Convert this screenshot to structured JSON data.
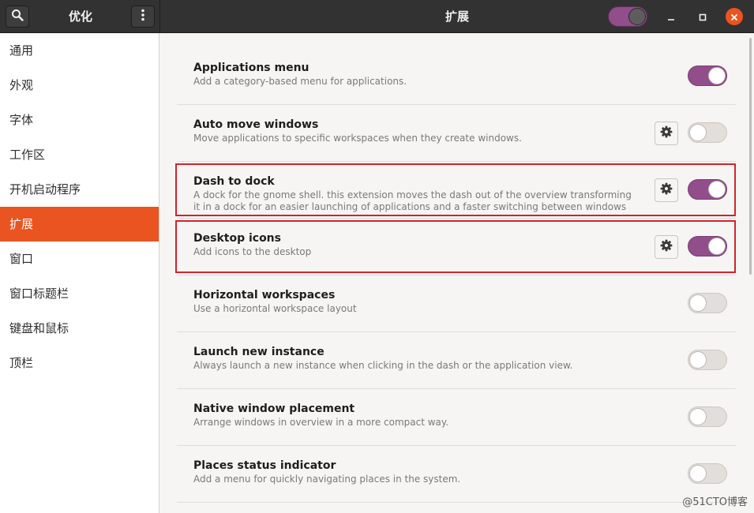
{
  "header": {
    "sidebar_title": "优化",
    "main_title": "扩展",
    "global_switch_on": true,
    "accent_color": "#924d8b",
    "close_color": "#e9541f",
    "search_icon": "search-icon",
    "menu_icon": "vertical-dots-icon"
  },
  "sidebar": {
    "active_color": "#e95420",
    "items": [
      {
        "label": "通用"
      },
      {
        "label": "外观"
      },
      {
        "label": "字体"
      },
      {
        "label": "工作区"
      },
      {
        "label": "开机启动程序"
      },
      {
        "label": "扩展",
        "active": true
      },
      {
        "label": "窗口"
      },
      {
        "label": "窗口标题栏"
      },
      {
        "label": "键盘和鼠标"
      },
      {
        "label": "顶栏"
      }
    ]
  },
  "extensions": [
    {
      "title": "Applications menu",
      "description": "Add a category-based menu for applications.",
      "enabled": true,
      "has_settings": false
    },
    {
      "title": "Auto move windows",
      "description": "Move applications to specific workspaces when they create windows.",
      "enabled": false,
      "has_settings": true
    },
    {
      "title": "Dash to dock",
      "description": "A dock for the gnome shell. this extension moves the dash out of the overview transforming it in a dock for an easier launching of applications and a faster switching between windows and desktops. s…",
      "enabled": true,
      "has_settings": true,
      "highlighted": true
    },
    {
      "title": "Desktop icons",
      "description": "Add icons to the desktop",
      "enabled": true,
      "has_settings": true,
      "highlighted": true
    },
    {
      "title": "Horizontal workspaces",
      "description": "Use a horizontal workspace layout",
      "enabled": false,
      "has_settings": false
    },
    {
      "title": "Launch new instance",
      "description": "Always launch a new instance when clicking in the dash or the application view.",
      "enabled": false,
      "has_settings": false
    },
    {
      "title": "Native window placement",
      "description": "Arrange windows in overview in a more compact way.",
      "enabled": false,
      "has_settings": false
    },
    {
      "title": "Places status indicator",
      "description": "Add a menu for quickly navigating places in the system.",
      "enabled": false,
      "has_settings": false
    }
  ],
  "watermark": "@51CTO博客"
}
